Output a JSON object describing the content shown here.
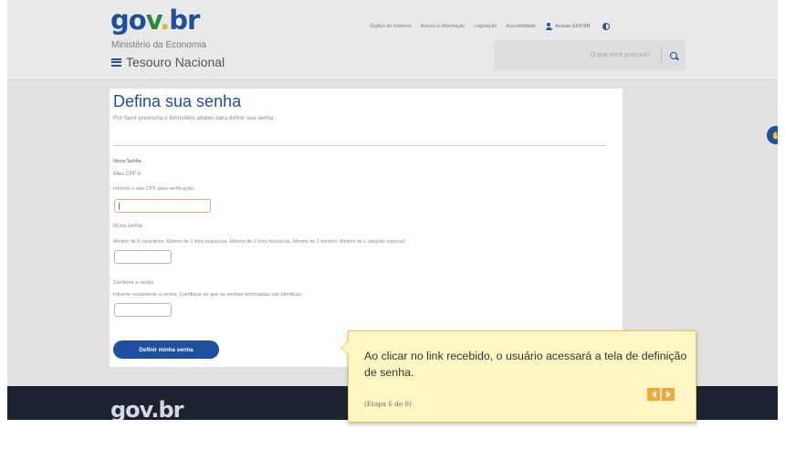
{
  "header": {
    "logo": {
      "part1": "go",
      "part2": "v",
      "part3": ".",
      "part4": "br"
    },
    "ministry": "Ministério da Economia",
    "site_name": "Tesouro Nacional",
    "nav_links": [
      "Órgãos do Governo",
      "Acesso à Informação",
      "Legislação",
      "Acessibilidade"
    ],
    "access_label": "Acesso GOV.BR",
    "search_placeholder": "O que você procura?"
  },
  "form": {
    "title": "Defina sua senha",
    "subtitle": "Por favor preencha o formulário abaixo para definir sua senha.",
    "section_label": "Nova Senha",
    "cpf_label": "Meu CPF é",
    "cpf_help": "Informe o seu CPF para verificação.",
    "password_label": "Nova senha",
    "password_help": "Mínimo de 8 caracteres. Mínimo de 1 letra maiúscula. Mínimo de 1 letra minúscula. Mínimo de 1 número. Mínimo de 1 caracter especial.",
    "confirm_label": "Confirme a senha",
    "confirm_help": "Informe novamente a senha. Certifique-se que as senhas informadas são idênticas.",
    "submit_label": "Definir minha senha"
  },
  "footer": {
    "logo": "gov.br"
  },
  "tooltip": {
    "text": "Ao clicar no link recebido, o usuário acessará a tela de definição de senha.",
    "step": "(Etapa 6 de 9)"
  },
  "colors": {
    "brand_blue": "#1f4fa1",
    "tooltip_bg": "#fff7c3",
    "nav_orange": "#f2a83a",
    "footer": "#1c2330"
  }
}
